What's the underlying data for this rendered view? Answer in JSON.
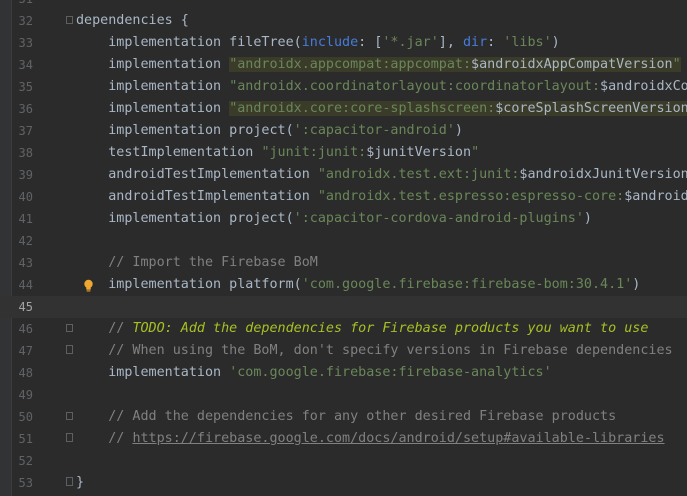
{
  "editor": {
    "lines": [
      {
        "num": "31",
        "parts": []
      },
      {
        "num": "32",
        "parts": [
          [
            "plain",
            "dependencies {"
          ]
        ]
      },
      {
        "num": "33",
        "parts": [
          [
            "plain",
            "    implementation fileTree("
          ],
          [
            "named",
            "include"
          ],
          [
            "plain",
            ": ["
          ],
          [
            "str",
            "'*.jar'"
          ],
          [
            "plain",
            "], "
          ],
          [
            "named",
            "dir"
          ],
          [
            "plain",
            ": "
          ],
          [
            "str",
            "'libs'"
          ],
          [
            "plain",
            ")"
          ]
        ]
      },
      {
        "num": "34",
        "parts": [
          [
            "plain",
            "    implementation "
          ],
          [
            "hlstr",
            "\"androidx.appcompat:appcompat:"
          ],
          [
            "hlvar",
            "$androidxAppCompatVersion"
          ],
          [
            "hlstr",
            "\""
          ]
        ]
      },
      {
        "num": "35",
        "parts": [
          [
            "plain",
            "    implementation "
          ],
          [
            "str",
            "\"androidx.coordinatorlayout:coordinatorlayout:"
          ],
          [
            "var",
            "$androidxCoordinatorLayoutVersion"
          ],
          [
            "str",
            "\""
          ]
        ]
      },
      {
        "num": "36",
        "parts": [
          [
            "plain",
            "    implementation "
          ],
          [
            "hlstr",
            "\"androidx.core:core-splashscreen:"
          ],
          [
            "hlvar",
            "$coreSplashScreenVersion"
          ],
          [
            "hlstr",
            "\""
          ]
        ]
      },
      {
        "num": "37",
        "parts": [
          [
            "plain",
            "    implementation project("
          ],
          [
            "str",
            "':capacitor-android'"
          ],
          [
            "plain",
            ")"
          ]
        ]
      },
      {
        "num": "38",
        "parts": [
          [
            "plain",
            "    testImplementation "
          ],
          [
            "str",
            "\"junit:junit:"
          ],
          [
            "var",
            "$junitVersion"
          ],
          [
            "str",
            "\""
          ]
        ]
      },
      {
        "num": "39",
        "parts": [
          [
            "plain",
            "    androidTestImplementation "
          ],
          [
            "str",
            "\"androidx.test.ext:junit:"
          ],
          [
            "var",
            "$androidxJunitVersion"
          ],
          [
            "str",
            "\""
          ]
        ]
      },
      {
        "num": "40",
        "parts": [
          [
            "plain",
            "    androidTestImplementation "
          ],
          [
            "str",
            "\"androidx.test.espresso:espresso-core:"
          ],
          [
            "var",
            "$androidxEspressoCoreVersion"
          ],
          [
            "str",
            "\""
          ]
        ]
      },
      {
        "num": "41",
        "parts": [
          [
            "plain",
            "    implementation project("
          ],
          [
            "str",
            "':capacitor-cordova-android-plugins'"
          ],
          [
            "plain",
            ")"
          ]
        ]
      },
      {
        "num": "42",
        "parts": []
      },
      {
        "num": "43",
        "parts": [
          [
            "cmt",
            "    // Import the Firebase BoM"
          ]
        ]
      },
      {
        "num": "44",
        "parts": [
          [
            "plain",
            "    implementation platform("
          ],
          [
            "str",
            "'com.google.firebase:firebase-bom:30.4.1'"
          ],
          [
            "plain",
            ")"
          ]
        ]
      },
      {
        "num": "45",
        "parts": []
      },
      {
        "num": "46",
        "parts": [
          [
            "cmt",
            "    // "
          ],
          [
            "todo",
            "TODO: Add the dependencies for Firebase products you want to use"
          ]
        ]
      },
      {
        "num": "47",
        "parts": [
          [
            "cmt",
            "    // When using the BoM, don't specify versions in Firebase dependencies"
          ]
        ]
      },
      {
        "num": "48",
        "parts": [
          [
            "plain",
            "    implementation "
          ],
          [
            "str",
            "'com.google.firebase:firebase-analytics'"
          ]
        ]
      },
      {
        "num": "49",
        "parts": []
      },
      {
        "num": "50",
        "parts": [
          [
            "cmt",
            "    // Add the dependencies for any other desired Firebase products"
          ]
        ]
      },
      {
        "num": "51",
        "parts": [
          [
            "cmt",
            "    // "
          ],
          [
            "link",
            "https://firebase.google.com/docs/android/setup#available-libraries"
          ]
        ]
      },
      {
        "num": "52",
        "parts": []
      },
      {
        "num": "53",
        "parts": [
          [
            "plain",
            "}"
          ]
        ]
      }
    ],
    "current_line": "45",
    "fold_markers": {
      "32": "start",
      "46": "start",
      "47": "end",
      "50": "start",
      "51": "end",
      "53": "end"
    },
    "intention_bulb_line": "44",
    "icons": [
      "fold-start-icon",
      "fold-end-icon",
      "intention-bulb-icon"
    ],
    "colors": {
      "background": "#2b2b2b",
      "keyword": "#cc7832",
      "string": "#6a8759",
      "comment": "#808080",
      "todo": "#a8c023",
      "named_arg": "#467cda",
      "highlight": "#3b3b29"
    }
  }
}
